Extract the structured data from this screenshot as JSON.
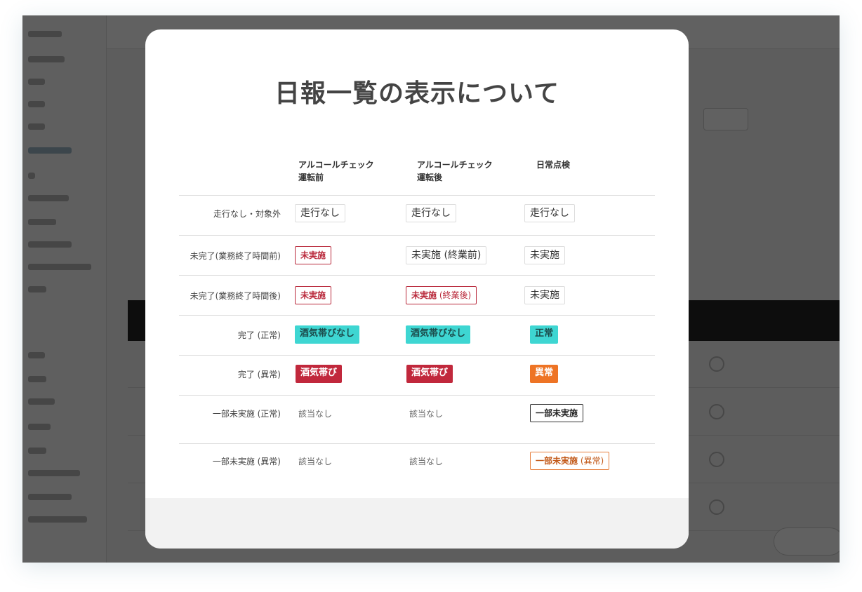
{
  "modal": {
    "title": "日報一覧の表示について",
    "columns": [
      {
        "line1": "アルコールチェック",
        "line2": "運転前"
      },
      {
        "line1": "アルコールチェック",
        "line2": "運転後"
      },
      {
        "line1": "日常点検",
        "line2": ""
      }
    ],
    "rows": [
      {
        "label": "走行なし・対象外",
        "cells": [
          {
            "style": "plain",
            "text": "走行なし",
            "sub": ""
          },
          {
            "style": "plain",
            "text": "走行なし",
            "sub": ""
          },
          {
            "style": "plain",
            "text": "走行なし",
            "sub": ""
          }
        ]
      },
      {
        "label": "未完了(業務終了時間前)",
        "cells": [
          {
            "style": "red-outline",
            "text": "未実施",
            "sub": ""
          },
          {
            "style": "plain",
            "text": "未実施 (終業前)",
            "sub": ""
          },
          {
            "style": "plain",
            "text": "未実施",
            "sub": ""
          }
        ]
      },
      {
        "label": "未完了(業務終了時間後)",
        "cells": [
          {
            "style": "red-outline",
            "text": "未実施",
            "sub": ""
          },
          {
            "style": "red-outline",
            "text": "未実施",
            "sub": " (終業後)"
          },
          {
            "style": "plain",
            "text": "未実施",
            "sub": ""
          }
        ]
      },
      {
        "label": "完了 (正常)",
        "cells": [
          {
            "style": "teal",
            "text": "酒気帯びなし",
            "sub": ""
          },
          {
            "style": "teal",
            "text": "酒気帯びなし",
            "sub": ""
          },
          {
            "style": "teal",
            "text": "正常",
            "sub": ""
          }
        ]
      },
      {
        "label": "完了 (異常)",
        "cells": [
          {
            "style": "red",
            "text": "酒気帯び",
            "sub": ""
          },
          {
            "style": "red",
            "text": "酒気帯び",
            "sub": ""
          },
          {
            "style": "orange",
            "text": "異常",
            "sub": ""
          }
        ]
      },
      {
        "label": "一部未実施 (正常)",
        "cells": [
          {
            "style": "na",
            "text": "該当なし",
            "sub": ""
          },
          {
            "style": "na",
            "text": "該当なし",
            "sub": ""
          },
          {
            "style": "dark-outline",
            "text": "一部未実施",
            "sub": ""
          }
        ]
      },
      {
        "label": "一部未実施 (異常)",
        "cells": [
          {
            "style": "na",
            "text": "該当なし",
            "sub": ""
          },
          {
            "style": "na",
            "text": "該当なし",
            "sub": ""
          },
          {
            "style": "orange-outline",
            "text": "一部未実施",
            "sub": " (異常)"
          }
        ]
      }
    ]
  },
  "colors": {
    "teal": "#3ed6d2",
    "red": "#c1283c",
    "orange": "#ee7425",
    "overlay": "rgba(0,0,0,0.62)"
  }
}
